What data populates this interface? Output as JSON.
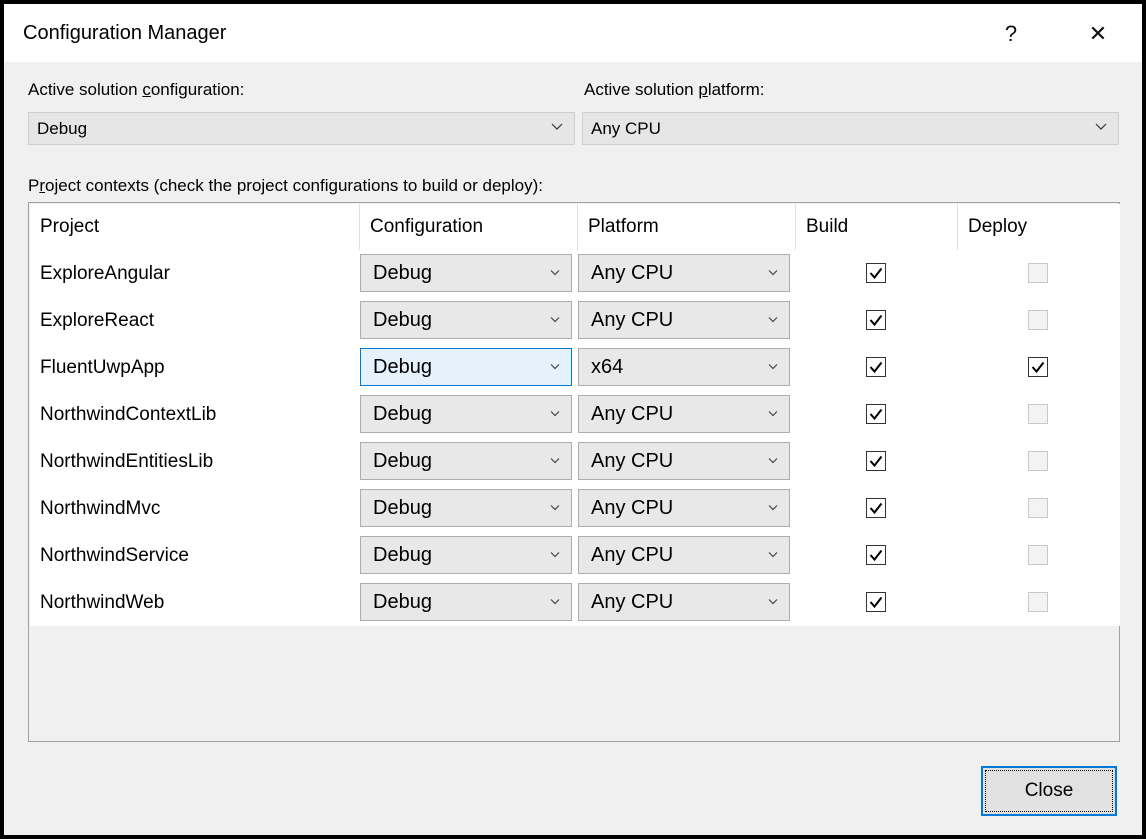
{
  "window": {
    "title": "Configuration Manager",
    "help_glyph": "?",
    "close_glyph": "✕"
  },
  "solution": {
    "config_label_pre": "Active solution ",
    "config_label_mnemonic": "c",
    "config_label_post": "onfiguration:",
    "config_value": "Debug",
    "platform_label_pre": "Active solution ",
    "platform_label_mnemonic": "p",
    "platform_label_post": "latform:",
    "platform_value": "Any CPU"
  },
  "contexts_label_pre": "P",
  "contexts_label_mnemonic": "r",
  "contexts_label_post": "oject contexts (check the project configurations to build or deploy):",
  "grid": {
    "columns": [
      "Project",
      "Configuration",
      "Platform",
      "Build",
      "Deploy"
    ],
    "rows": [
      {
        "project": "ExploreAngular",
        "configuration": "Debug",
        "platform": "Any CPU",
        "build": true,
        "deploy": false,
        "deploy_enabled": false
      },
      {
        "project": "ExploreReact",
        "configuration": "Debug",
        "platform": "Any CPU",
        "build": true,
        "deploy": false,
        "deploy_enabled": false
      },
      {
        "project": "FluentUwpApp",
        "configuration": "Debug",
        "platform": "x64",
        "build": true,
        "deploy": true,
        "deploy_enabled": true
      },
      {
        "project": "NorthwindContextLib",
        "configuration": "Debug",
        "platform": "Any CPU",
        "build": true,
        "deploy": false,
        "deploy_enabled": false
      },
      {
        "project": "NorthwindEntitiesLib",
        "configuration": "Debug",
        "platform": "Any CPU",
        "build": true,
        "deploy": false,
        "deploy_enabled": false
      },
      {
        "project": "NorthwindMvc",
        "configuration": "Debug",
        "platform": "Any CPU",
        "build": true,
        "deploy": false,
        "deploy_enabled": false
      },
      {
        "project": "NorthwindService",
        "configuration": "Debug",
        "platform": "Any CPU",
        "build": true,
        "deploy": false,
        "deploy_enabled": false
      },
      {
        "project": "NorthwindWeb",
        "configuration": "Debug",
        "platform": "Any CPU",
        "build": true,
        "deploy": false,
        "deploy_enabled": false
      }
    ]
  },
  "close_button": "Close"
}
